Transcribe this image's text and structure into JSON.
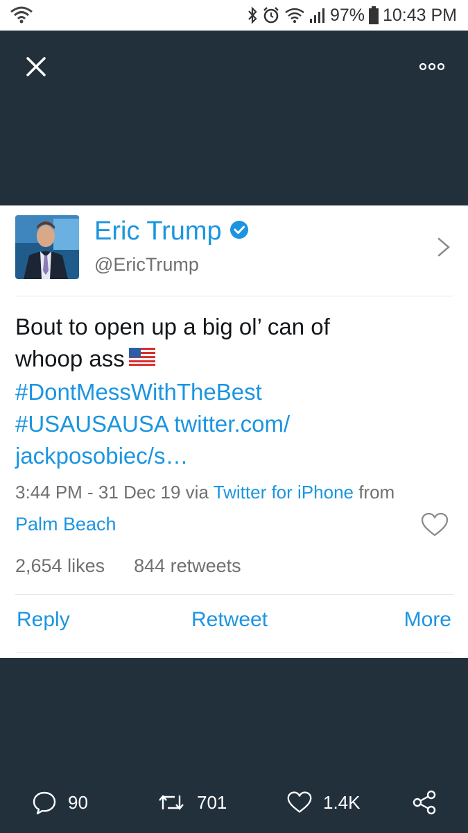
{
  "status_bar": {
    "battery_percent": "97%",
    "time": "10:43 PM"
  },
  "tweet": {
    "author_name": "Eric Trump",
    "author_handle": "@EricTrump",
    "verified": true,
    "text_line1": "Bout to open up a big ol’ can of",
    "text_line2": "whoop ass",
    "hashtag1": "#DontMessWithTheBest",
    "hashtag2": "#USAUSAUSA",
    "link_part1": "twitter.com/",
    "link_part2": "jackposobiec/s…",
    "timestamp": "3:44 PM - 31 Dec 19 via ",
    "source": "Twitter for iPhone",
    "from_text": " from",
    "location": "Palm Beach",
    "likes": "2,654 likes",
    "retweets": "844 retweets"
  },
  "actions": {
    "reply": "Reply",
    "retweet": "Retweet",
    "more": "More"
  },
  "bottom_bar": {
    "replies_count": "90",
    "retweets_count": "701",
    "likes_count": "1.4K"
  },
  "colors": {
    "accent": "#1b95e0",
    "overlay_bg": "#22303c",
    "muted_text": "#707070"
  }
}
